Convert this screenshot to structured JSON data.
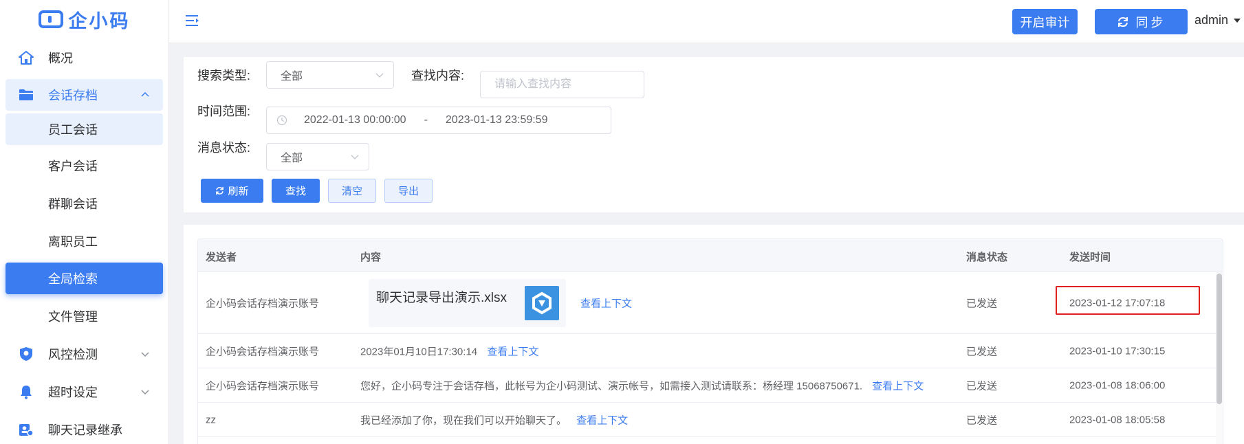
{
  "app": {
    "logo_text": "企小码"
  },
  "sidebar": {
    "items": [
      {
        "label": "概况",
        "icon": "home-icon"
      },
      {
        "label": "会话存档",
        "icon": "folder-icon",
        "expanded": true
      },
      {
        "label": "员工会话"
      },
      {
        "label": "客户会话"
      },
      {
        "label": "群聊会话"
      },
      {
        "label": "离职员工"
      },
      {
        "label": "全局检索",
        "selected": true
      },
      {
        "label": "文件管理"
      },
      {
        "label": "风控检测",
        "icon": "shield-icon"
      },
      {
        "label": "超时设定",
        "icon": "bell-icon"
      },
      {
        "label": "聊天记录继承",
        "icon": "user-transfer-icon"
      }
    ]
  },
  "header": {
    "audit_label": "开启审计",
    "sync_label": "同步",
    "user": "admin"
  },
  "filter": {
    "search_type_label": "搜索类型:",
    "search_type_value": "全部",
    "keyword_label": "查找内容:",
    "keyword_placeholder": "请输入查找内容",
    "time_label": "时间范围:",
    "time_start": "2022-01-13 00:00:00",
    "time_sep": "-",
    "time_end": "2023-01-13 23:59:59",
    "status_label": "消息状态:",
    "status_value": "全部",
    "btn_refresh": "刷新",
    "btn_search": "查找",
    "btn_clear": "清空",
    "btn_export": "导出"
  },
  "table": {
    "columns": [
      "发送者",
      "内容",
      "消息状态",
      "发送时间"
    ],
    "rows": [
      {
        "sender": "企小码会话存档演示账号",
        "file_name": "聊天记录导出演示.xlsx",
        "content": "",
        "link": "查看上下文",
        "status": "已发送",
        "time": "2023-01-12 17:07:18"
      },
      {
        "sender": "企小码会话存档演示账号",
        "content": "2023年01月10日17:30:14",
        "link": "查看上下文",
        "status": "已发送",
        "time": "2023-01-10 17:30:15"
      },
      {
        "sender": "企小码会话存档演示账号",
        "content": "您好，企小码专注于会话存档，此帐号为企小码测试、演示帐号，如需接入测试请联系：杨经理 15068750671.",
        "link": "查看上下文",
        "status": "已发送",
        "time": "2023-01-08 18:06:00"
      },
      {
        "sender": "zz",
        "content": "我已经添加了你，现在我们可以开始聊天了。",
        "link": "查看上下文",
        "status": "已发送",
        "time": "2023-01-08 18:05:58"
      }
    ]
  },
  "colors": {
    "accent": "#3b7cf0",
    "highlight_box": "#e02020"
  }
}
